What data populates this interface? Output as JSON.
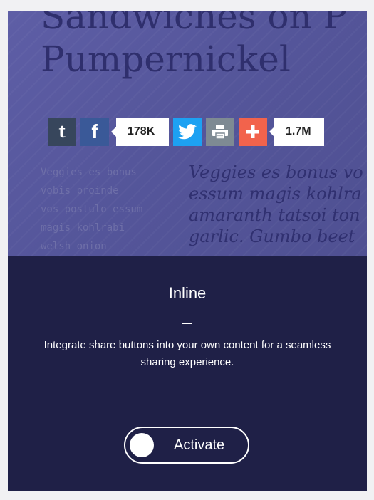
{
  "preview": {
    "headline": {
      "line1": "Sandwiches on P",
      "line2": "Pumpernickel"
    },
    "share_bar": {
      "tumblr_icon": "tumblr-icon",
      "facebook_icon": "facebook-icon",
      "facebook_count": "178K",
      "twitter_icon": "twitter-icon",
      "print_icon": "print-icon",
      "plus_icon": "plus-icon",
      "plus_count": "1.7M"
    },
    "mono_lines": [
      "Veggies es bonus",
      "vobis proinde",
      "vos postulo essum",
      "magis kohlrabi",
      "welsh onion"
    ],
    "italic_lines": [
      "Veggies es bonus vo",
      "essum magis kohlra",
      "amaranth tatsoi ton",
      "garlic. Gumbo beet"
    ]
  },
  "info": {
    "title": "Inline",
    "description": "Integrate share buttons into your own content for a seamless sharing experience.",
    "activate_label": "Activate"
  },
  "colors": {
    "card_dark": "#1f2047",
    "preview_bg": "#5a5aa0",
    "tumblr": "#37465c",
    "facebook": "#3a5998",
    "twitter": "#1da1f2",
    "print": "#7e8a93",
    "plus": "#f2634c"
  }
}
